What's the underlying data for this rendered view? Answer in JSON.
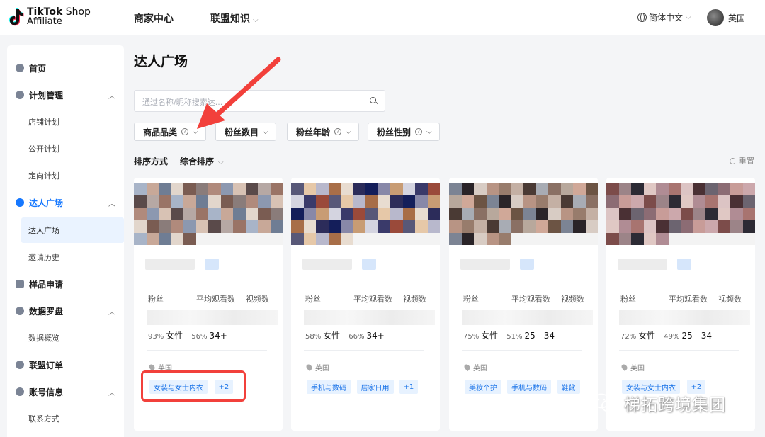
{
  "logo": {
    "brand": "TikTok",
    "word_shop": " Shop",
    "subtitle": "Affiliate"
  },
  "topnav": {
    "item1": "商家中心",
    "item2": "联盟知识",
    "language": "简体中文",
    "region": "英国"
  },
  "sidebar": {
    "items": [
      {
        "label": "首页"
      },
      {
        "label": "计划管理"
      },
      {
        "label": "店铺计划"
      },
      {
        "label": "公开计划"
      },
      {
        "label": "定向计划"
      },
      {
        "label": "达人广场"
      },
      {
        "label": "达人广场"
      },
      {
        "label": "邀请历史"
      },
      {
        "label": "样品申请"
      },
      {
        "label": "数据罗盘"
      },
      {
        "label": "数据概览"
      },
      {
        "label": "联盟订单"
      },
      {
        "label": "账号信息"
      },
      {
        "label": "联系方式"
      }
    ]
  },
  "page": {
    "title": "达人广场"
  },
  "search": {
    "placeholder": "通过名称/昵称搜索达..."
  },
  "filters": {
    "f1": "商品品类",
    "f2": "粉丝数目",
    "f3": "粉丝年龄",
    "f4": "粉丝性别"
  },
  "sort": {
    "label": "排序方式",
    "value": "综合排序",
    "reset": "重置"
  },
  "stat_headers": {
    "fans": "粉丝",
    "avg_views": "平均观看数",
    "videos": "视频数"
  },
  "cards": [
    {
      "gender_pct": "93%",
      "gender": "女性",
      "age_pct": "56%",
      "age": "34+",
      "location": "英国",
      "tags": [
        "女装与女士内衣",
        "+2"
      ]
    },
    {
      "gender_pct": "58%",
      "gender": "女性",
      "age_pct": "66%",
      "age": "34+",
      "location": "英国",
      "tags": [
        "手机与数码",
        "居家日用",
        "+1"
      ]
    },
    {
      "gender_pct": "75%",
      "gender": "女性",
      "age_pct": "51%",
      "age": "25 - 34",
      "location": "英国",
      "tags": [
        "美妆个护",
        "手机与数码",
        "鞋靴"
      ]
    },
    {
      "gender_pct": "72%",
      "gender": "女性",
      "age_pct": "49%",
      "age": "25 - 34",
      "location": "英国",
      "tags": [
        "女装与女士内衣",
        "+2"
      ]
    }
  ],
  "watermark": {
    "text": "梯拓跨境集团"
  },
  "colors": {
    "accent": "#1678ff",
    "annotation": "#f2403b",
    "tag_bg": "#e7f2ff",
    "tag_text": "#1a73e8"
  }
}
